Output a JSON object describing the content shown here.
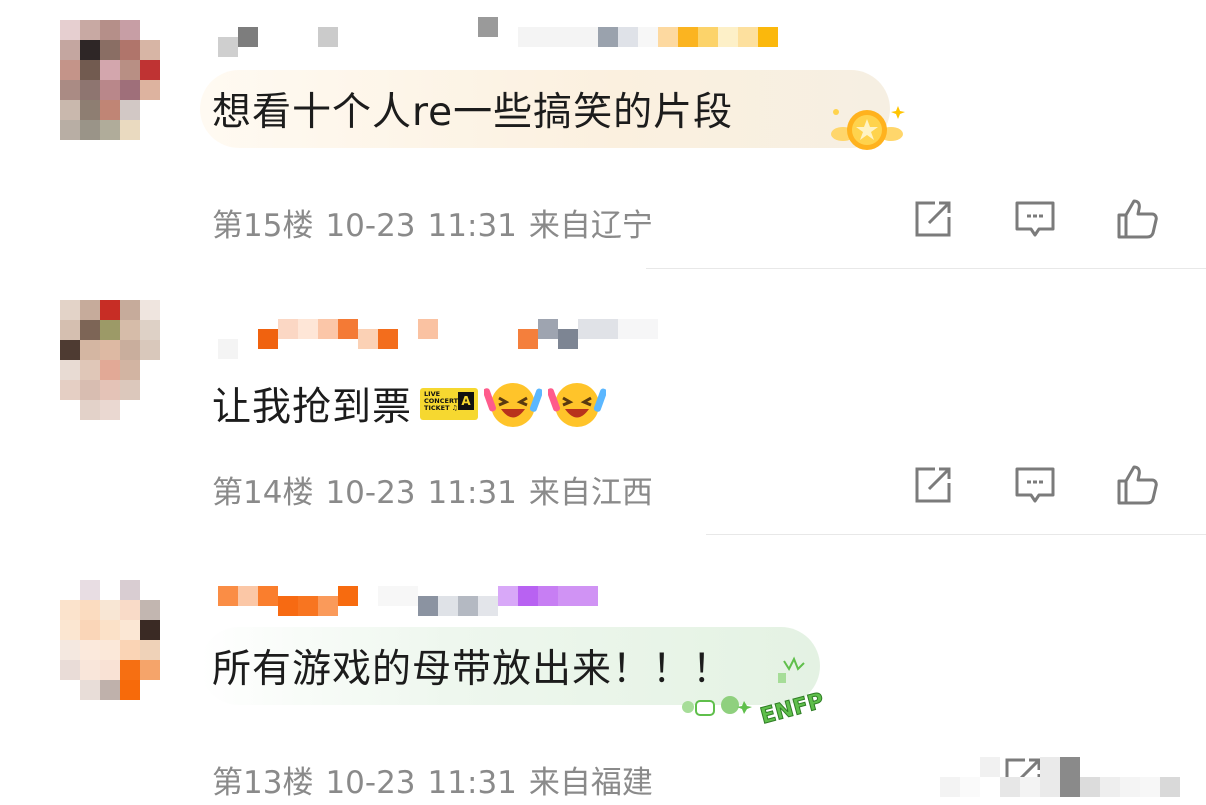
{
  "comments": [
    {
      "text": "想看十个人re一些搞笑的片段",
      "floor": "第15楼",
      "date": "10-23",
      "time": "11:31",
      "location": "来自辽宁"
    },
    {
      "text": "让我抢到票",
      "floor": "第14楼",
      "date": "10-23",
      "time": "11:31",
      "location": "来自江西",
      "ticket": {
        "lines": [
          "LIVE",
          "CONCERT",
          "TICKET ♫"
        ],
        "zone": "A"
      }
    },
    {
      "text": "所有游戏的母带放出来！！！",
      "floor": "第13楼",
      "date": "10-23",
      "time": "11:31",
      "location": "来自福建",
      "badge_text": "ENFP"
    }
  ],
  "icons": [
    "share-icon",
    "comment-icon",
    "like-icon",
    "star-badge-icon",
    "laughing-emoji-icon"
  ],
  "colors": {
    "meta_text": "#8a8a8a",
    "icon_gray": "#7b7b7b",
    "bubble1": "#fbf1e0",
    "bubble3": "#e6f3e6",
    "badge_green": "#5fbf4b"
  }
}
